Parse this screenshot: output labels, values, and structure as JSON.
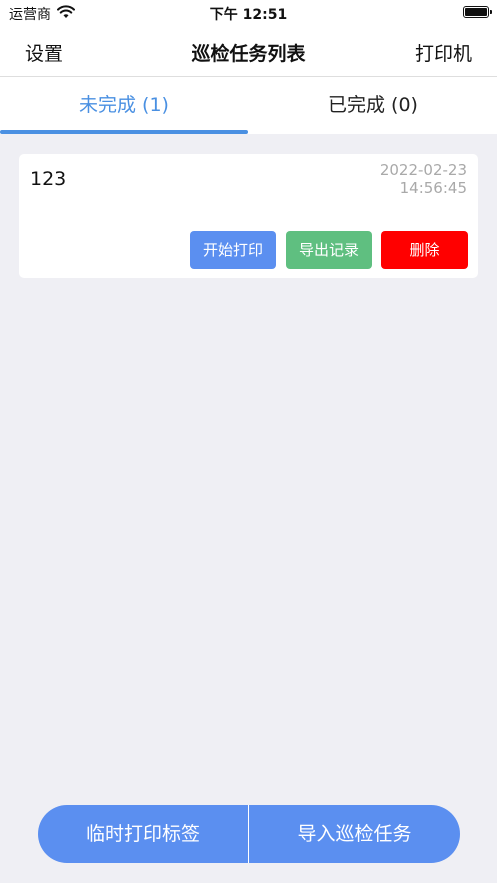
{
  "status_bar": {
    "carrier": "运营商",
    "time": "下午 12:51",
    "battery_level": 1.0
  },
  "nav": {
    "left_label": "设置",
    "title": "巡检任务列表",
    "right_label": "打印机"
  },
  "tabs": [
    {
      "label": "未完成 (1)",
      "active": true
    },
    {
      "label": "已完成 (0)",
      "active": false
    }
  ],
  "tasks": [
    {
      "name": "123",
      "date": "2022-02-23",
      "time": "14:56:45",
      "buttons": {
        "print": "开始打印",
        "export": "导出记录",
        "delete": "删除"
      }
    }
  ],
  "bottom": {
    "temp_print": "临时打印标签",
    "import_task": "导入巡检任务"
  },
  "colors": {
    "accent": "#4a90e2",
    "primary_button": "#5b8ff0",
    "export_button": "#5fbf80",
    "delete_button": "#ff0000",
    "background": "#efeff4"
  },
  "icons": [
    "wifi-icon",
    "battery-icon"
  ]
}
